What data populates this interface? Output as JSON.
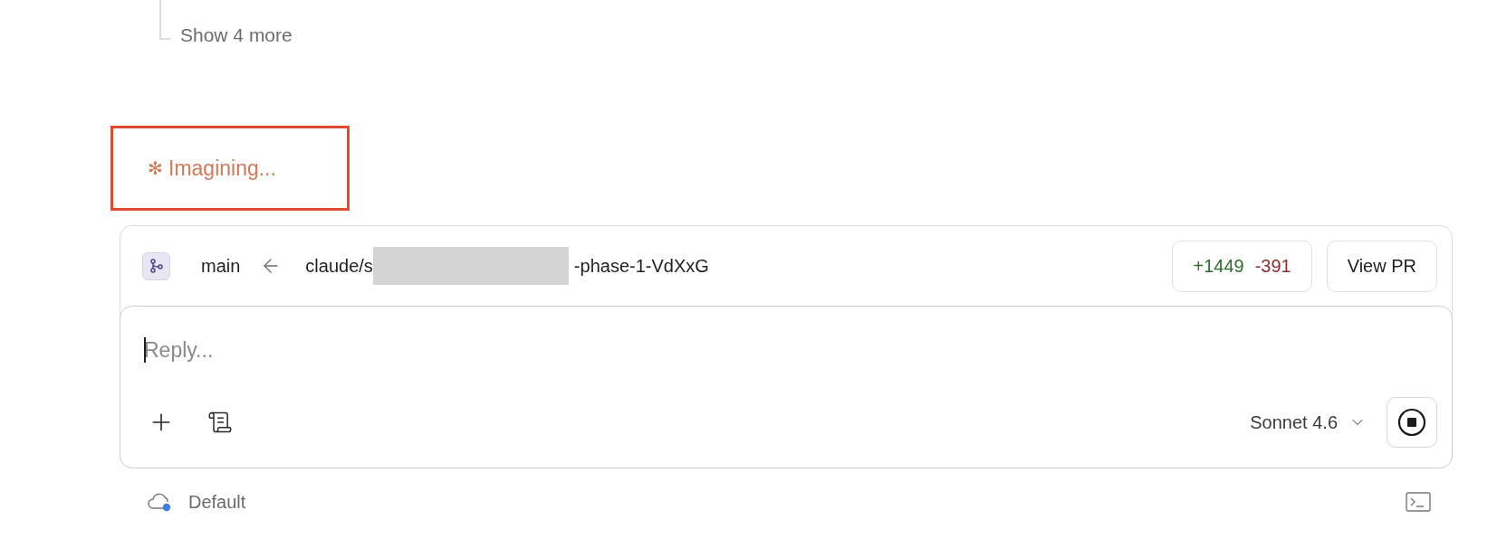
{
  "thread": {
    "show_more": "Show 4 more"
  },
  "status": {
    "glyph": "✻",
    "text": "Imagining...",
    "highlighted": true
  },
  "branch": {
    "base": "main",
    "head_prefix": "claude/s",
    "head_redacted": true,
    "head_suffix": "-phase-1-VdXxG",
    "additions": "+1449",
    "deletions": "-391",
    "view_pr": "View PR"
  },
  "composer": {
    "placeholder": "Reply...",
    "model": "Sonnet 4.6"
  },
  "footer": {
    "environment": "Default"
  }
}
